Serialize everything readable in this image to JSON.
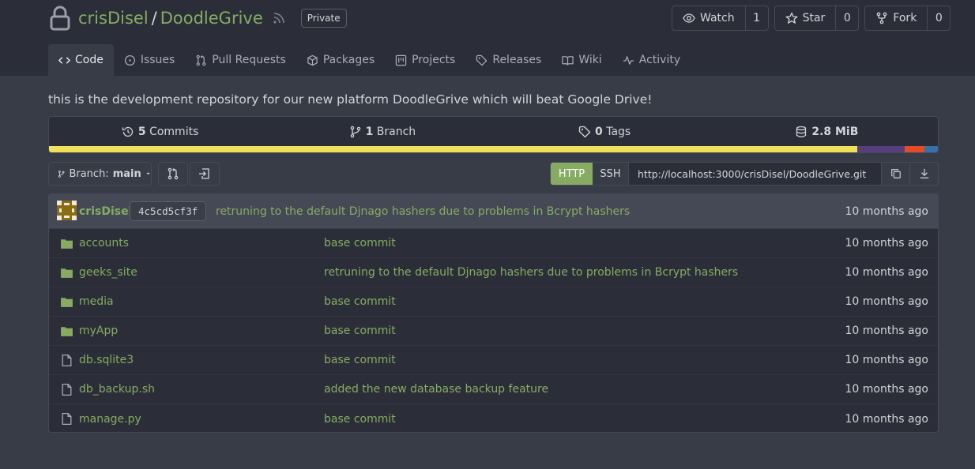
{
  "repo": {
    "owner": "crisDisel",
    "separator": "/",
    "name": "DoodleGrive",
    "visibility": "Private",
    "description": "this is the development repository for our new platform DoodleGrive which will beat Google Drive!"
  },
  "actions": {
    "watch_label": "Watch",
    "watch_count": "1",
    "star_label": "Star",
    "star_count": "0",
    "fork_label": "Fork",
    "fork_count": "0"
  },
  "tabs": [
    {
      "label": "Code",
      "icon": "code-icon"
    },
    {
      "label": "Issues",
      "icon": "issue-icon"
    },
    {
      "label": "Pull Requests",
      "icon": "pull-request-icon"
    },
    {
      "label": "Packages",
      "icon": "package-icon"
    },
    {
      "label": "Projects",
      "icon": "project-icon"
    },
    {
      "label": "Releases",
      "icon": "tag-icon"
    },
    {
      "label": "Wiki",
      "icon": "book-icon"
    },
    {
      "label": "Activity",
      "icon": "pulse-icon"
    }
  ],
  "stats": {
    "commits_count": "5",
    "commits_label": "Commits",
    "branches_count": "1",
    "branches_label": "Branch",
    "tags_count": "0",
    "tags_label": "Tags",
    "size": "2.8 MiB"
  },
  "language_bar": [
    {
      "color": "#f1e05a",
      "percent": 90.9
    },
    {
      "color": "#563d7c",
      "percent": 5.4
    },
    {
      "color": "#e34c26",
      "percent": 2.2
    },
    {
      "color": "#3572a5",
      "percent": 1.5
    }
  ],
  "branch": {
    "label": "Branch:",
    "value": "main"
  },
  "clone": {
    "http_label": "HTTP",
    "ssh_label": "SSH",
    "url": "http://localhost:3000/crisDisel/DoodleGrive.git"
  },
  "latest_commit": {
    "author": "crisDisel",
    "sha": "4c5cd5cf3f",
    "message": "retruning to the default Djnago hashers due to problems in Bcrypt hashers",
    "time": "10 months ago"
  },
  "files": [
    {
      "name": "accounts",
      "type": "dir",
      "commit": "base commit",
      "time": "10 months ago"
    },
    {
      "name": "geeks_site",
      "type": "dir",
      "commit": "retruning to the default Djnago hashers due to problems in Bcrypt hashers",
      "time": "10 months ago"
    },
    {
      "name": "media",
      "type": "dir",
      "commit": "base commit",
      "time": "10 months ago"
    },
    {
      "name": "myApp",
      "type": "dir",
      "commit": "base commit",
      "time": "10 months ago"
    },
    {
      "name": "db.sqlite3",
      "type": "file",
      "commit": "base commit",
      "time": "10 months ago"
    },
    {
      "name": "db_backup.sh",
      "type": "file",
      "commit": "added the new database backup feature",
      "time": "10 months ago"
    },
    {
      "name": "manage.py",
      "type": "file",
      "commit": "base commit",
      "time": "10 months ago"
    }
  ],
  "colors": {
    "accent": "#87ab63",
    "header_bg": "#2b2e38",
    "page_bg": "#383c47"
  }
}
